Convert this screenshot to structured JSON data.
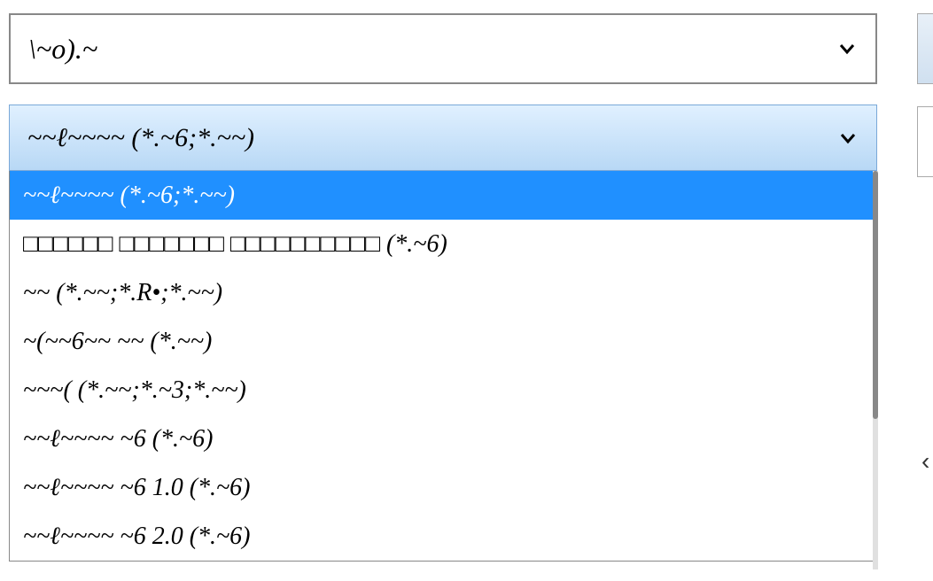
{
  "closed_dropdown": {
    "label": "\\~o).~"
  },
  "open_dropdown": {
    "header_label": "~~ℓ~~~~ (*.~6;*.~~)",
    "items": [
      {
        "label": "~~ℓ~~~~ (*.~6;*.~~)",
        "selected": true
      },
      {
        "label": "□□□□□□ □□□□□□□ □□□□□□□□□□ (*.~6)",
        "selected": false
      },
      {
        "label": "~~ (*.~~;*.R•;*.~~)",
        "selected": false
      },
      {
        "label": "~(~~6~~ ~~ (*.~~)",
        "selected": false
      },
      {
        "label": "~~~( (*.~~;*.~3;*.~~)",
        "selected": false
      },
      {
        "label": "~~ℓ~~~~ ~6 (*.~6)",
        "selected": false
      },
      {
        "label": "~~ℓ~~~~ ~6 1.0 (*.~6)",
        "selected": false
      },
      {
        "label": "~~ℓ~~~~ ~6 2.0 (*.~6)",
        "selected": false
      }
    ]
  }
}
